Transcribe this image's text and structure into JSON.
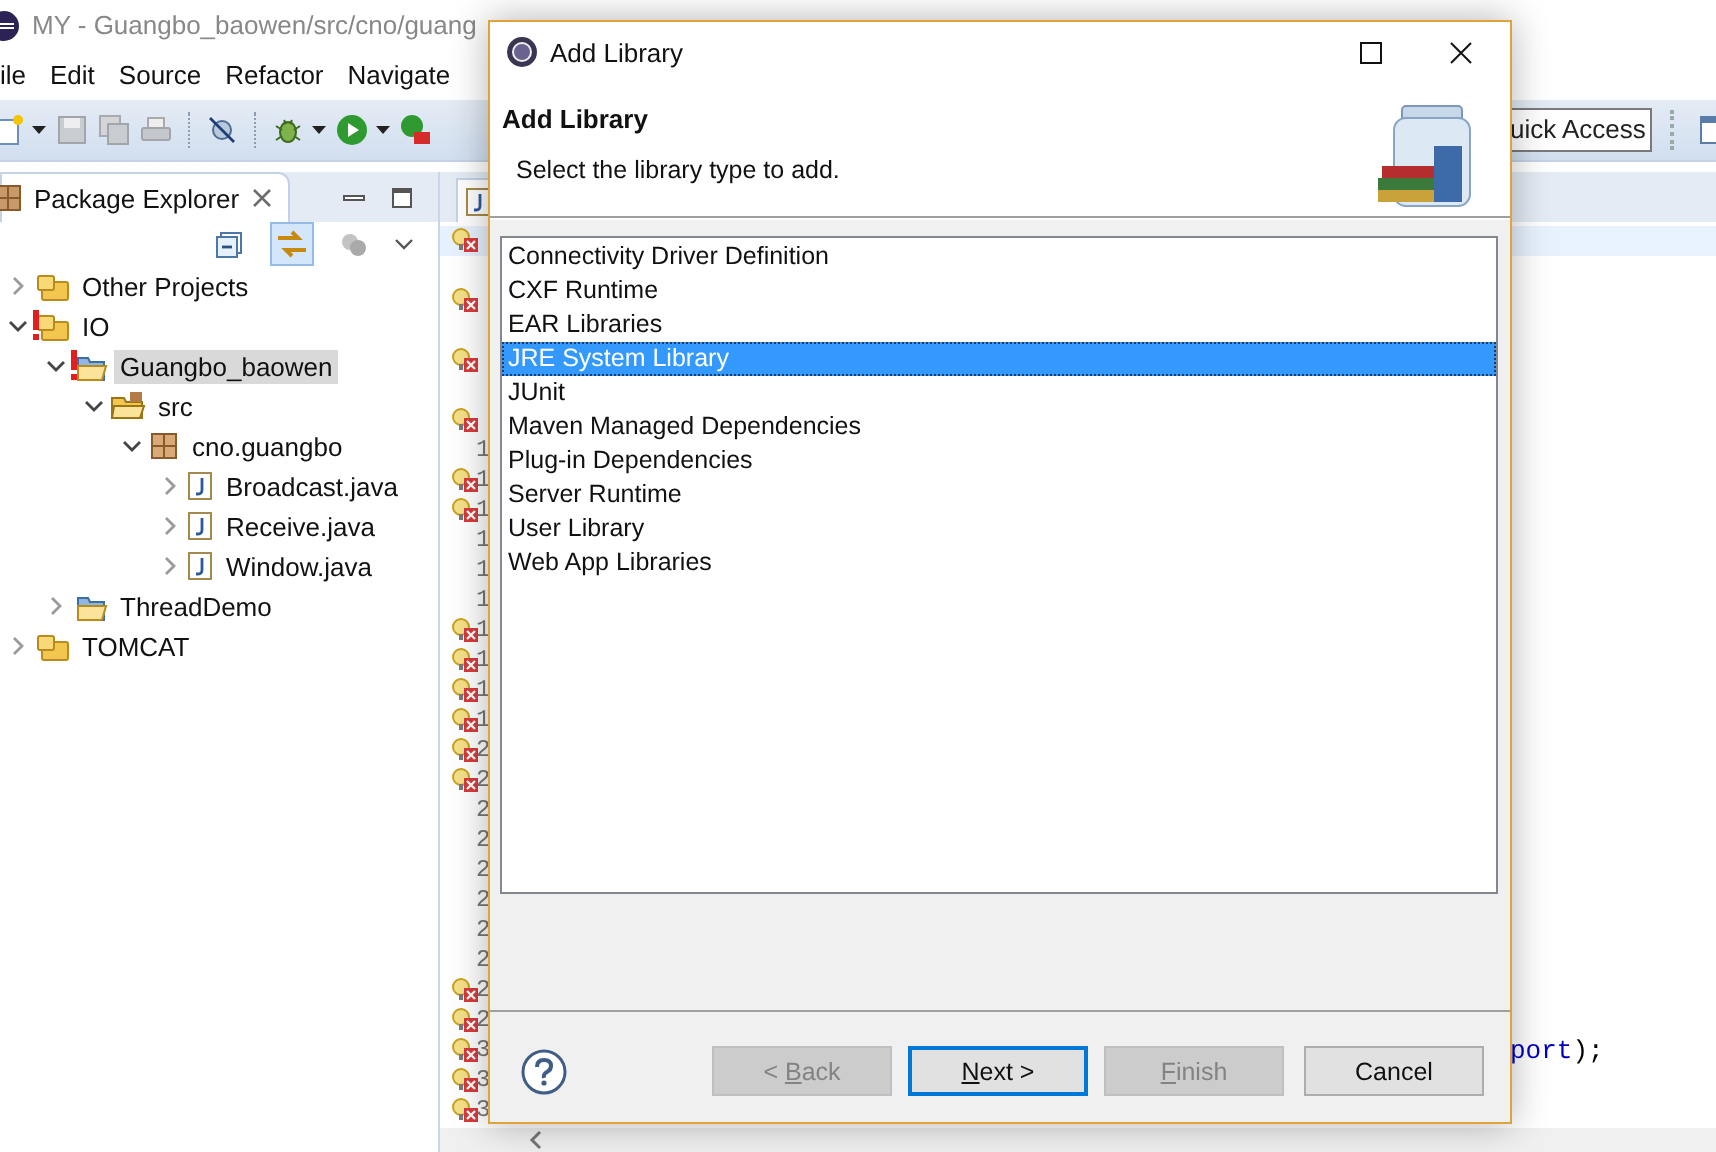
{
  "ide": {
    "title": "MY - Guangbo_baowen/src/cno/guang",
    "menu": [
      {
        "label": "ile"
      },
      {
        "label": "Edit"
      },
      {
        "label": "Source"
      },
      {
        "label": "Refactor"
      },
      {
        "label": "Navigate"
      }
    ],
    "quick_access": {
      "placeholder": "uick Access"
    },
    "package_explorer": {
      "title": "Package Explorer",
      "link_with_editor": true,
      "tree": [
        {
          "label": "Other Projects",
          "kind": "working_set",
          "expanded": false,
          "selected": false
        },
        {
          "label": "IO",
          "kind": "working_set",
          "expanded": true,
          "selected": false,
          "error": true,
          "children": [
            {
              "label": "Guangbo_baowen",
              "kind": "project",
              "expanded": true,
              "selected": true,
              "error": true,
              "children": [
                {
                  "label": "src",
                  "kind": "source_folder",
                  "expanded": true,
                  "selected": false,
                  "children": [
                    {
                      "label": "cno.guangbo",
                      "kind": "package",
                      "expanded": true,
                      "selected": false,
                      "children": [
                        {
                          "label": "Broadcast.java",
                          "kind": "java_file",
                          "expanded": false,
                          "selected": false
                        },
                        {
                          "label": "Receive.java",
                          "kind": "java_file",
                          "expanded": false,
                          "selected": false
                        },
                        {
                          "label": "Window.java",
                          "kind": "java_file",
                          "expanded": false,
                          "selected": false
                        }
                      ]
                    }
                  ]
                }
              ]
            },
            {
              "label": "ThreadDemo",
              "kind": "project",
              "expanded": false,
              "selected": false
            }
          ]
        },
        {
          "label": "TOMCAT",
          "kind": "working_set",
          "expanded": false,
          "selected": false
        }
      ]
    },
    "editor": {
      "lines": [
        {
          "error": true,
          "current": true
        },
        {
          "error": false,
          "current": false
        },
        {
          "error": true,
          "current": false
        },
        {
          "error": false,
          "current": false
        },
        {
          "error": true,
          "current": false
        },
        {
          "error": false,
          "current": false
        },
        {
          "error": true,
          "current": false
        },
        {
          "error": false,
          "number": "1",
          "current": false
        },
        {
          "error": true,
          "number": "1",
          "current": false
        },
        {
          "error": true,
          "number": "1",
          "current": false
        },
        {
          "error": false,
          "number": "1",
          "current": false
        },
        {
          "error": false,
          "number": "1",
          "current": false
        },
        {
          "error": false,
          "number": "1",
          "current": false
        },
        {
          "error": true,
          "number": "1",
          "current": false
        },
        {
          "error": true,
          "number": "1",
          "current": false
        },
        {
          "error": true,
          "number": "1",
          "current": false
        },
        {
          "error": true,
          "number": "1",
          "current": false
        },
        {
          "error": true,
          "number": "2",
          "current": false
        },
        {
          "error": true,
          "number": "2",
          "current": false
        },
        {
          "error": false,
          "number": "2",
          "current": false
        },
        {
          "error": false,
          "number": "2",
          "current": false
        },
        {
          "error": false,
          "number": "2",
          "current": false
        },
        {
          "error": false,
          "number": "2",
          "current": false
        },
        {
          "error": false,
          "number": "2",
          "current": false
        },
        {
          "error": false,
          "number": "2",
          "current": false
        },
        {
          "error": true,
          "number": "2",
          "current": false
        },
        {
          "error": true,
          "number": "2",
          "current": false
        },
        {
          "error": true,
          "number": "3",
          "current": false,
          "code": [
            {
              "text": "port",
              "kind": "field"
            },
            {
              "text": ");",
              "kind": "plain"
            }
          ]
        },
        {
          "error": true,
          "number": "3",
          "current": false
        },
        {
          "error": true,
          "number": "3",
          "current": false
        }
      ]
    }
  },
  "dialog": {
    "title": "Add Library",
    "heading": "Add Library",
    "description": "Select the library type to add.",
    "libraries": [
      {
        "label": "Connectivity Driver Definition",
        "selected": false
      },
      {
        "label": "CXF Runtime",
        "selected": false
      },
      {
        "label": "EAR Libraries",
        "selected": false
      },
      {
        "label": "JRE System Library",
        "selected": true
      },
      {
        "label": "JUnit",
        "selected": false
      },
      {
        "label": "Maven Managed Dependencies",
        "selected": false
      },
      {
        "label": "Plug-in Dependencies",
        "selected": false
      },
      {
        "label": "Server Runtime",
        "selected": false
      },
      {
        "label": "User Library",
        "selected": false
      },
      {
        "label": "Web App Libraries",
        "selected": false
      }
    ],
    "buttons": [
      {
        "before": "< ",
        "mnemonic": "B",
        "after": "ack",
        "disabled": true,
        "default": false
      },
      {
        "mnemonic": "N",
        "after": "ext >",
        "disabled": false,
        "default": true
      },
      {
        "mnemonic": "F",
        "after": "inish",
        "disabled": true,
        "default": false
      },
      {
        "after": "Cancel",
        "disabled": false,
        "default": false
      }
    ]
  }
}
